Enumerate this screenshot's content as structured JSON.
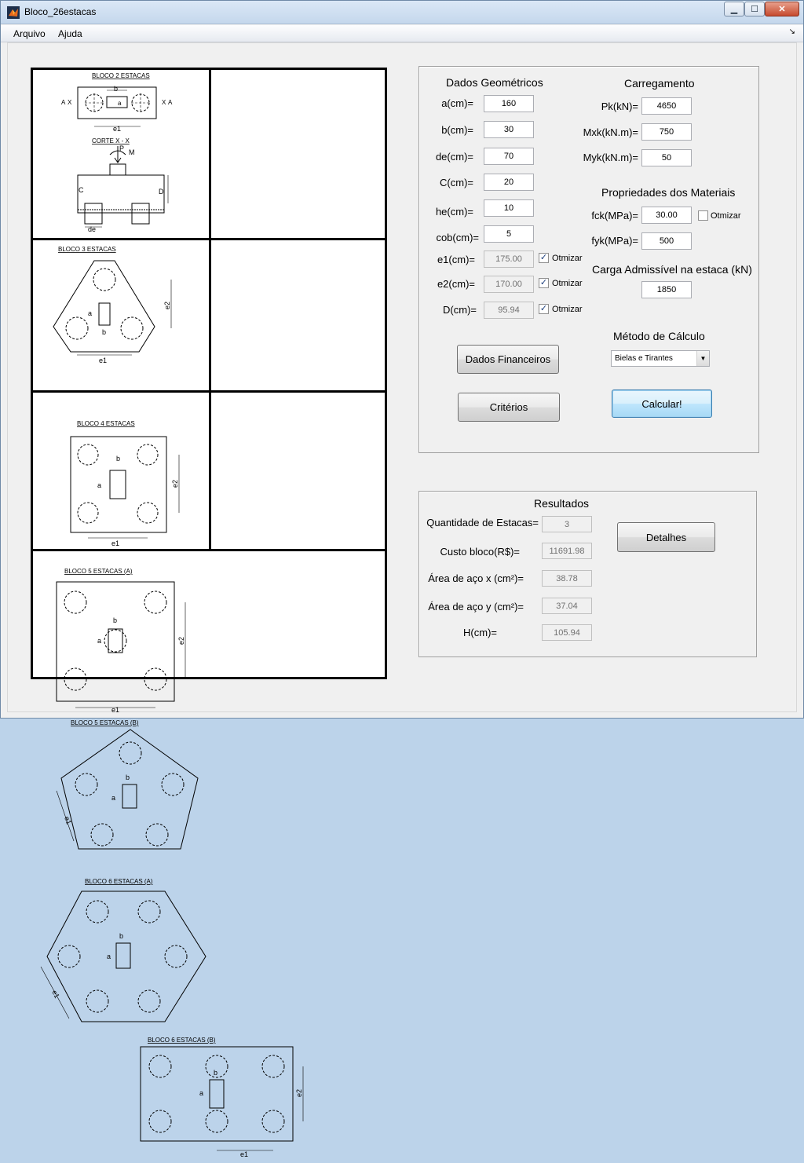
{
  "window": {
    "title": "Bloco_26estacas"
  },
  "menu": {
    "items": [
      "Arquivo",
      "Ajuda"
    ]
  },
  "drawings": {
    "b2": {
      "title": "BLOCO 2 ESTACAS",
      "section": "CORTE X - X"
    },
    "b3": {
      "title": "BLOCO 3 ESTACAS"
    },
    "b4": {
      "title": "BLOCO 4 ESTACAS"
    },
    "b5a": {
      "title": "BLOCO 5 ESTACAS (A)"
    },
    "b5b": {
      "title": "BLOCO 5 ESTACAS (B)"
    },
    "b6a": {
      "title": "BLOCO 6 ESTACAS (A)"
    },
    "b6b": {
      "title": "BLOCO 6 ESTACAS (B)"
    },
    "labels": {
      "a": "a",
      "b": "b",
      "e1": "e1",
      "e2": "e2",
      "X": "X",
      "P": "P",
      "M": "M",
      "C": "C",
      "D": "D",
      "de": "de"
    }
  },
  "geometricos": {
    "title": "Dados Geométricos",
    "rows": [
      {
        "label": "a(cm)=",
        "value": "160"
      },
      {
        "label": "b(cm)=",
        "value": "30"
      },
      {
        "label": "de(cm)=",
        "value": "70"
      },
      {
        "label": "C(cm)=",
        "value": "20"
      },
      {
        "label": "he(cm)=",
        "value": "10"
      },
      {
        "label": "cob(cm)=",
        "value": "5"
      }
    ],
    "opt_rows": [
      {
        "label": "e1(cm)=",
        "value": "175.00",
        "check": "Otmizar"
      },
      {
        "label": "e2(cm)=",
        "value": "170.00",
        "check": "Otmizar"
      },
      {
        "label": "D(cm)=",
        "value": "95.94",
        "check": "Otmizar"
      }
    ]
  },
  "carregamento": {
    "title": "Carregamento",
    "rows": [
      {
        "label": "Pk(kN)=",
        "value": "4650"
      },
      {
        "label": "Mxk(kN.m)=",
        "value": "750"
      },
      {
        "label": "Myk(kN.m)=",
        "value": "50"
      }
    ]
  },
  "materiais": {
    "title": "Propriedades dos Materiais",
    "fck_label": "fck(MPa)=",
    "fck": "30.00",
    "fck_check": "Otmizar",
    "fyk_label": "fyk(MPa)=",
    "fyk": "500"
  },
  "carga": {
    "title": "Carga Admissível na estaca (kN)",
    "value": "1850"
  },
  "metodo": {
    "title": "Método de Cálculo",
    "selected": "Bielas e Tirantes"
  },
  "buttons": {
    "financeiros": "Dados Financeiros",
    "criterios": "Critérios",
    "calcular": "Calcular!",
    "detalhes": "Detalhes"
  },
  "resultados": {
    "title": "Resultados",
    "rows": [
      {
        "label": "Quantidade de Estacas=",
        "value": "3"
      },
      {
        "label": "Custo bloco(R$)=",
        "value": "11691.98"
      },
      {
        "label": "Área de aço x (cm²)=",
        "value": "38.78"
      },
      {
        "label": "Área de aço y (cm²)=",
        "value": "37.04"
      },
      {
        "label": "H(cm)=",
        "value": "105.94"
      }
    ]
  },
  "colors": {
    "titlebar": "#c4d7ec",
    "focus_button": "#a7d9f5",
    "panel_bg": "#f0f0f0"
  }
}
